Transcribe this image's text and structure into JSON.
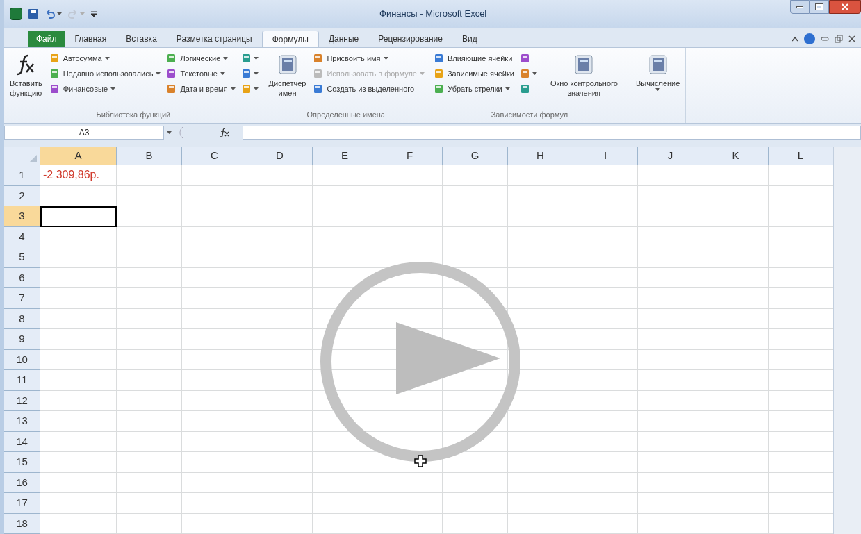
{
  "window": {
    "title": "Финансы - Microsoft Excel"
  },
  "quick_access": [
    {
      "kind": "save",
      "disabled": false
    },
    {
      "kind": "undo",
      "disabled": false
    },
    {
      "kind": "redo",
      "disabled": true
    }
  ],
  "tabs": [
    {
      "label": "Файл",
      "kind": "file",
      "selected": false
    },
    {
      "label": "Главная",
      "kind": "tab",
      "selected": false
    },
    {
      "label": "Вставка",
      "kind": "tab",
      "selected": false
    },
    {
      "label": "Разметка страницы",
      "kind": "tab",
      "selected": false
    },
    {
      "label": "Формулы",
      "kind": "tab",
      "selected": true
    },
    {
      "label": "Данные",
      "kind": "tab",
      "selected": false
    },
    {
      "label": "Рецензирование",
      "kind": "tab",
      "selected": false
    },
    {
      "label": "Вид",
      "kind": "tab",
      "selected": false
    }
  ],
  "ribbon": {
    "groups": [
      {
        "label": "Библиотека функций",
        "columns": [
          [
            {
              "kind": "big",
              "label": "Вставить функцию",
              "dropdown": false,
              "disabled": false
            }
          ],
          [
            {
              "kind": "small",
              "label": "Автосумма",
              "dropdown": true,
              "disabled": false
            },
            {
              "kind": "small",
              "label": "Недавно использовались",
              "dropdown": true,
              "disabled": false
            },
            {
              "kind": "small",
              "label": "Финансовые",
              "dropdown": true,
              "disabled": false
            }
          ],
          [
            {
              "kind": "small",
              "label": "Логические",
              "dropdown": true,
              "disabled": false
            },
            {
              "kind": "small",
              "label": "Текстовые",
              "dropdown": true,
              "disabled": false
            },
            {
              "kind": "small",
              "label": "Дата и время",
              "dropdown": true,
              "disabled": false
            }
          ],
          [
            {
              "kind": "icon",
              "dropdown": true,
              "disabled": false
            },
            {
              "kind": "icon",
              "dropdown": true,
              "disabled": false
            },
            {
              "kind": "icon",
              "dropdown": true,
              "disabled": false
            }
          ]
        ]
      },
      {
        "label": "Определенные имена",
        "columns": [
          [
            {
              "kind": "big",
              "label": "Диспетчер имен",
              "dropdown": false,
              "disabled": false
            }
          ],
          [
            {
              "kind": "small",
              "label": "Присвоить имя",
              "dropdown": true,
              "disabled": false
            },
            {
              "kind": "small",
              "label": "Использовать в формуле",
              "dropdown": true,
              "disabled": true
            },
            {
              "kind": "small",
              "label": "Создать из выделенного",
              "dropdown": false,
              "disabled": false
            }
          ]
        ]
      },
      {
        "label": "Зависимости формул",
        "columns": [
          [
            {
              "kind": "small",
              "label": "Влияющие ячейки",
              "dropdown": false,
              "disabled": false
            },
            {
              "kind": "small",
              "label": "Зависимые ячейки",
              "dropdown": false,
              "disabled": false
            },
            {
              "kind": "small",
              "label": "Убрать стрелки",
              "dropdown": true,
              "disabled": false
            }
          ],
          [
            {
              "kind": "icon",
              "dropdown": false,
              "disabled": false
            },
            {
              "kind": "icon",
              "dropdown": true,
              "disabled": false
            },
            {
              "kind": "icon",
              "dropdown": false,
              "disabled": false
            }
          ],
          [
            {
              "kind": "big",
              "label": "Окно контрольного значения",
              "dropdown": false,
              "disabled": false
            }
          ]
        ]
      },
      {
        "columns": [
          [
            {
              "kind": "big",
              "label": "Вычисление",
              "dropdown": true,
              "disabled": false
            }
          ]
        ]
      }
    ]
  },
  "formula_bar": {
    "name_box": "A3"
  },
  "sheet": {
    "columns": [
      {
        "label": "A",
        "selected": true
      },
      {
        "label": "B",
        "selected": false
      },
      {
        "label": "C",
        "selected": false
      },
      {
        "label": "D",
        "selected": false
      },
      {
        "label": "E",
        "selected": false
      },
      {
        "label": "F",
        "selected": false
      },
      {
        "label": "G",
        "selected": false
      },
      {
        "label": "H",
        "selected": false
      },
      {
        "label": "I",
        "selected": false
      },
      {
        "label": "J",
        "selected": false
      },
      {
        "label": "K",
        "selected": false
      },
      {
        "label": "L",
        "selected": false
      }
    ],
    "rows": [
      {
        "label": "1",
        "selected": false,
        "cells": [
          {
            "text": "-2 309,86р.",
            "color": "#d0392b"
          }
        ]
      },
      {
        "label": "2",
        "selected": false,
        "cells": []
      },
      {
        "label": "3",
        "selected": true,
        "cells": []
      },
      {
        "label": "4",
        "selected": false,
        "cells": []
      },
      {
        "label": "5",
        "selected": false,
        "cells": []
      },
      {
        "label": "6",
        "selected": false,
        "cells": []
      },
      {
        "label": "7",
        "selected": false,
        "cells": []
      },
      {
        "label": "8",
        "selected": false,
        "cells": []
      },
      {
        "label": "9",
        "selected": false,
        "cells": []
      },
      {
        "label": "10",
        "selected": false,
        "cells": []
      },
      {
        "label": "11",
        "selected": false,
        "cells": []
      },
      {
        "label": "12",
        "selected": false,
        "cells": []
      },
      {
        "label": "13",
        "selected": false,
        "cells": []
      },
      {
        "label": "14",
        "selected": false,
        "cells": []
      },
      {
        "label": "15",
        "selected": false,
        "cells": []
      },
      {
        "label": "16",
        "selected": false,
        "cells": []
      },
      {
        "label": "17",
        "selected": false,
        "cells": []
      },
      {
        "label": "18",
        "selected": false,
        "cells": []
      }
    ]
  },
  "video_overlay": {
    "kind": "play"
  }
}
